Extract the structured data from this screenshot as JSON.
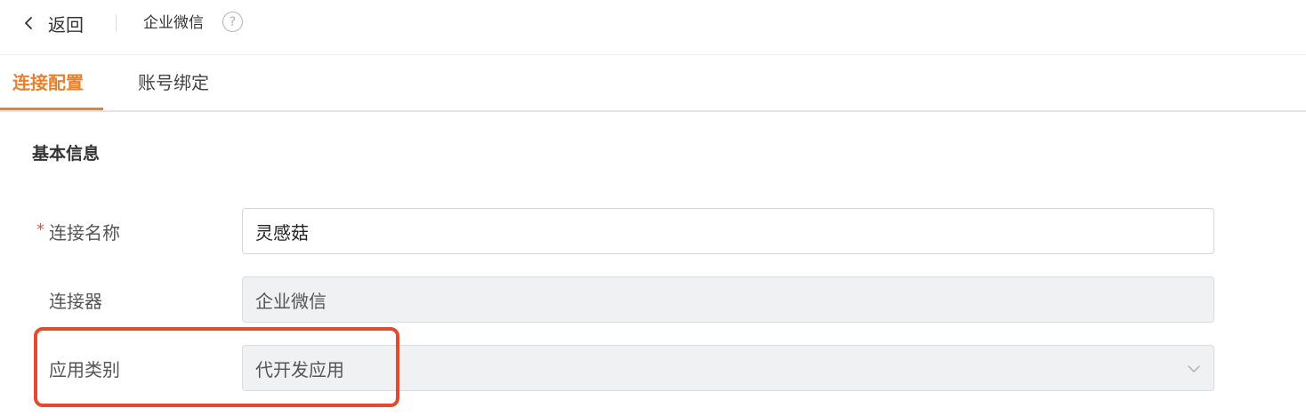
{
  "header": {
    "back_label": "返回",
    "title": "企业微信",
    "help_icon_glyph": "?"
  },
  "tabs": [
    {
      "label": "连接配置",
      "active": true
    },
    {
      "label": "账号绑定",
      "active": false
    }
  ],
  "section": {
    "title": "基本信息"
  },
  "form": {
    "connection_name": {
      "label": "连接名称",
      "required_mark": "*",
      "value": "灵感菇"
    },
    "connector": {
      "label": "连接器",
      "value": "企业微信"
    },
    "app_category": {
      "label": "应用类别",
      "value": "代开发应用"
    }
  },
  "colors": {
    "accent": "#e5812f",
    "highlight": "#e14b2e",
    "required": "#e5533d",
    "disabled_bg": "#f0f1f3"
  }
}
